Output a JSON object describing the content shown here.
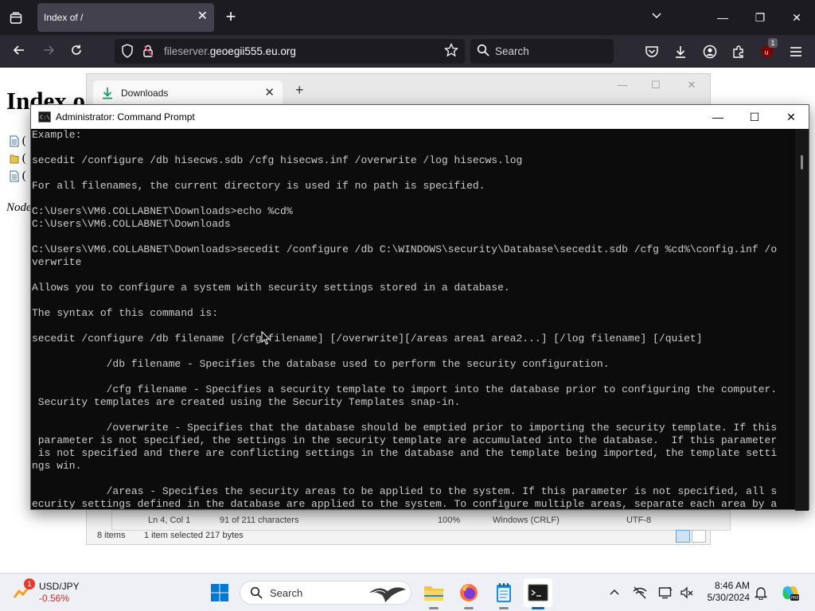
{
  "browser": {
    "tab_title": "Index of /",
    "url_host_prefix": "fileserver.",
    "url_host_domain": "geoegii555.eu.org",
    "search_placeholder": "Search",
    "extension_badge": "1"
  },
  "page": {
    "heading": "Index o",
    "file_rows": [
      "(",
      "(",
      "("
    ],
    "footer": "Node"
  },
  "explorer": {
    "tab_title": "Downloads",
    "status_items": "8 items",
    "status_selected": "1 item selected  217 bytes"
  },
  "notepad_status": {
    "position": "Ln 4, Col 1",
    "chars": "91 of 211 characters",
    "zoom": "100%",
    "line_endings": "Windows (CRLF)",
    "encoding": "UTF-8"
  },
  "cmd": {
    "title": "Administrator: Command Prompt",
    "lines": [
      "Example:",
      "",
      "secedit /configure /db hisecws.sdb /cfg hisecws.inf /overwrite /log hisecws.log",
      "",
      "For all filenames, the current directory is used if no path is specified.",
      "",
      "C:\\Users\\VM6.COLLABNET\\Downloads>echo %cd%",
      "C:\\Users\\VM6.COLLABNET\\Downloads",
      "",
      "C:\\Users\\VM6.COLLABNET\\Downloads>secedit /configure /db C:\\WINDOWS\\security\\Database\\secedit.sdb /cfg %cd%\\config.inf /o",
      "verwrite",
      "",
      "Allows you to configure a system with security settings stored in a database.",
      "",
      "The syntax of this command is:",
      "",
      "secedit /configure /db filename [/cfg filename] [/overwrite][/areas area1 area2...] [/log filename] [/quiet]",
      "",
      "            /db filename - Specifies the database used to perform the security configuration.",
      "",
      "            /cfg filename - Specifies a security template to import into the database prior to configuring the computer.",
      " Security templates are created using the Security Templates snap-in.",
      "",
      "            /overwrite - Specifies that the database should be emptied prior to importing the security template. If this",
      " parameter is not specified, the settings in the security template are accumulated into the database.  If this parameter",
      " is not specified and there are conflicting settings in the database and the template being imported, the template setti",
      "ngs win.",
      "",
      "            /areas - Specifies the security areas to be applied to the system. If this parameter is not specified, all s",
      "ecurity settings defined in the database are applied to the system. To configure multiple areas, separate each area by a"
    ]
  },
  "taskbar": {
    "widget_badge": "1",
    "widget_pair": "USD/JPY",
    "widget_change": "-0.56%",
    "search_label": "Search",
    "time": "8:46 AM",
    "date": "5/30/2024"
  },
  "colors": {
    "browser_dark": "#1c1b22",
    "console_bg": "#0c0c0c",
    "console_text": "#cccccc",
    "taskbar_bg": "#eef0f5",
    "accent": "#0067c0",
    "negative": "#c42b1c"
  }
}
